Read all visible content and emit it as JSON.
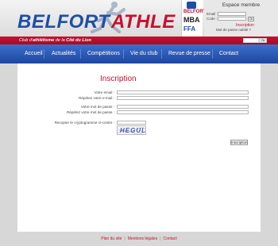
{
  "header": {
    "logo": {
      "word1": "BELFORT",
      "word2": "ATHLE"
    },
    "partners": {
      "belfort": "BELFORT",
      "mba": "MBA",
      "ffa": "FFA"
    }
  },
  "member": {
    "title": "Espace membre",
    "email_label": "Email :",
    "code_label": "Code :",
    "ok_label": "Ok",
    "inscription_link": "Inscription",
    "lost_password_link": "Mot de passe oublié ?"
  },
  "band": {
    "tagline_parts": [
      "Club d'",
      "athlétisme",
      " de la ",
      "Cité du Lion"
    ],
    "search_button": "Ok"
  },
  "nav": {
    "items": [
      "Accueil",
      "Actualités",
      "Compétitions",
      "Vie du club",
      "Revue de presse",
      "Contact"
    ]
  },
  "form": {
    "title": "Inscription",
    "email_label": "Votre email :",
    "email_confirm_label": "Répétez votre e-mail :",
    "password_label": "Votre mot de passe :",
    "password_confirm_label": "Répétez votre mot de passe :",
    "captcha_label": "Recopier le cryptogramme ci-contre :",
    "captcha_text": "HEGUL",
    "submit_label": "Inscription"
  },
  "footer": {
    "links": [
      "Plan du site",
      "Mentions légales",
      "Contact"
    ],
    "separator": "|"
  },
  "colors": {
    "brand_red": "#c8102e",
    "brand_blue": "#1f4fa5",
    "nav_blue": "#2d5bb8",
    "background": "#d7d7d7"
  }
}
